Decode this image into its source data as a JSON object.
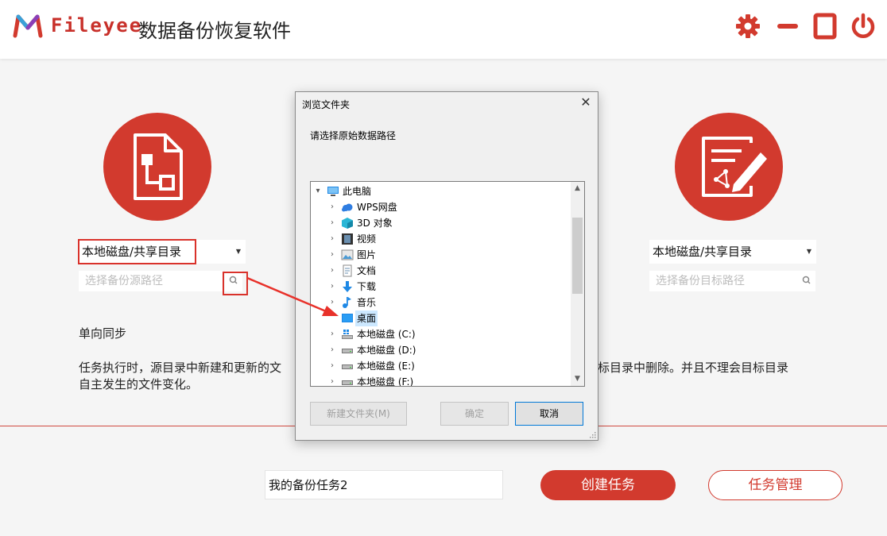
{
  "app": {
    "brand": "Fileyee",
    "title": "数据备份恢复软件"
  },
  "source": {
    "select_value": "本地磁盘/共享目录",
    "path_placeholder": "选择备份源路径"
  },
  "target": {
    "select_value": "本地磁盘/共享目录",
    "path_placeholder": "选择备份目标路径"
  },
  "mode": {
    "title": "单向同步",
    "desc_line1_left": "任务执行时，源目录中新建和更新的文",
    "desc_line1_right": "标目录中删除。并且不理会目标目录",
    "desc_line2": "自主发生的文件变化。"
  },
  "task": {
    "name_value": "我的备份任务2",
    "create_label": "创建任务",
    "manage_label": "任务管理"
  },
  "dialog": {
    "title": "浏览文件夹",
    "prompt": "请选择原始数据路径",
    "tree": [
      {
        "label": "此电脑",
        "icon": "computer-icon",
        "level": 0,
        "expanded": true
      },
      {
        "label": "WPS网盘",
        "icon": "cloud-icon",
        "level": 1
      },
      {
        "label": "3D 对象",
        "icon": "cube-icon",
        "level": 1
      },
      {
        "label": "视频",
        "icon": "video-icon",
        "level": 1
      },
      {
        "label": "图片",
        "icon": "picture-icon",
        "level": 1
      },
      {
        "label": "文档",
        "icon": "document-icon",
        "level": 1
      },
      {
        "label": "下载",
        "icon": "download-icon",
        "level": 1
      },
      {
        "label": "音乐",
        "icon": "music-icon",
        "level": 1
      },
      {
        "label": "桌面",
        "icon": "desktop-icon",
        "level": 1,
        "selected": true
      },
      {
        "label": "本地磁盘 (C:)",
        "icon": "drive-icon",
        "level": 1
      },
      {
        "label": "本地磁盘 (D:)",
        "icon": "drive-icon",
        "level": 1
      },
      {
        "label": "本地磁盘 (E:)",
        "icon": "drive-icon",
        "level": 1
      },
      {
        "label": "本地磁盘 (F:)",
        "icon": "drive-icon",
        "level": 1
      }
    ],
    "new_folder_label": "新建文件夹(M)",
    "ok_label": "确定",
    "cancel_label": "取消"
  },
  "colors": {
    "accent": "#d23a2e",
    "highlight_box": "#d9322b",
    "selection": "#cce8ff"
  }
}
